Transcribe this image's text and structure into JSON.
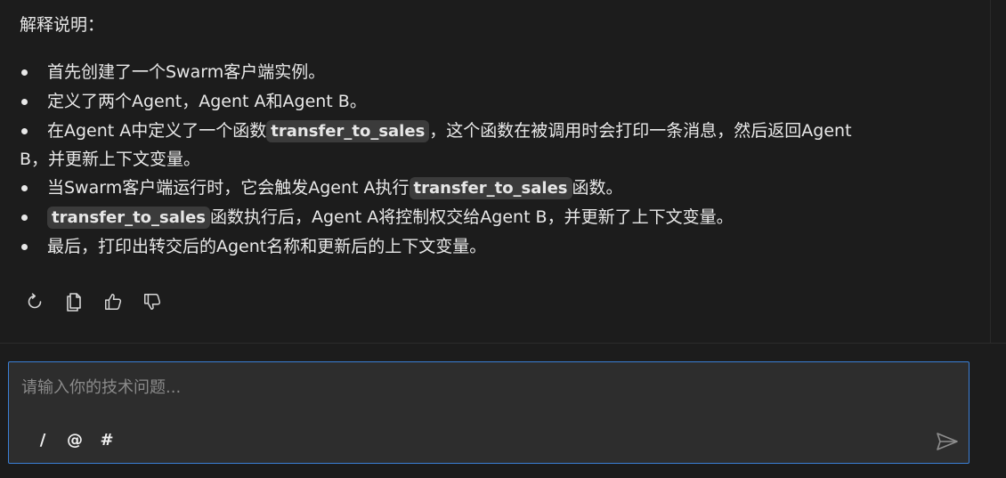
{
  "message": {
    "heading": "解释说明：",
    "bullets": [
      {
        "text": "首先创建了一个Swarm客户端实例。"
      },
      {
        "text": "定义了两个Agent，Agent A和Agent B。"
      },
      {
        "before": "在Agent A中定义了一个函数",
        "code": "transfer_to_sales",
        "after": "，这个函数在被调用时会打印一条消息，然后返回Agent",
        "after2": "B，并更新上下文变量。"
      },
      {
        "before": "当Swarm客户端运行时，它会触发Agent A执行",
        "code": "transfer_to_sales",
        "after": "函数。"
      },
      {
        "code": "transfer_to_sales",
        "after": "函数执行后，Agent A将控制权交给Agent B，并更新了上下文变量。"
      },
      {
        "text": "最后，打印出转交后的Agent名称和更新后的上下文变量。"
      }
    ]
  },
  "actions": [
    {
      "icon": "refresh-icon"
    },
    {
      "icon": "copy-icon"
    },
    {
      "icon": "thumbs-up-icon"
    },
    {
      "icon": "thumbs-down-icon"
    }
  ],
  "composer": {
    "placeholder": "请输入你的技术问题...",
    "value": "",
    "tools": [
      "/",
      "@",
      "#"
    ],
    "send_icon": "send-icon"
  },
  "colors": {
    "background": "#1c1c1c",
    "composer_bg": "#2d2d2d",
    "focus_border": "#3b7fd6",
    "code_bg": "#3b3b3b"
  }
}
